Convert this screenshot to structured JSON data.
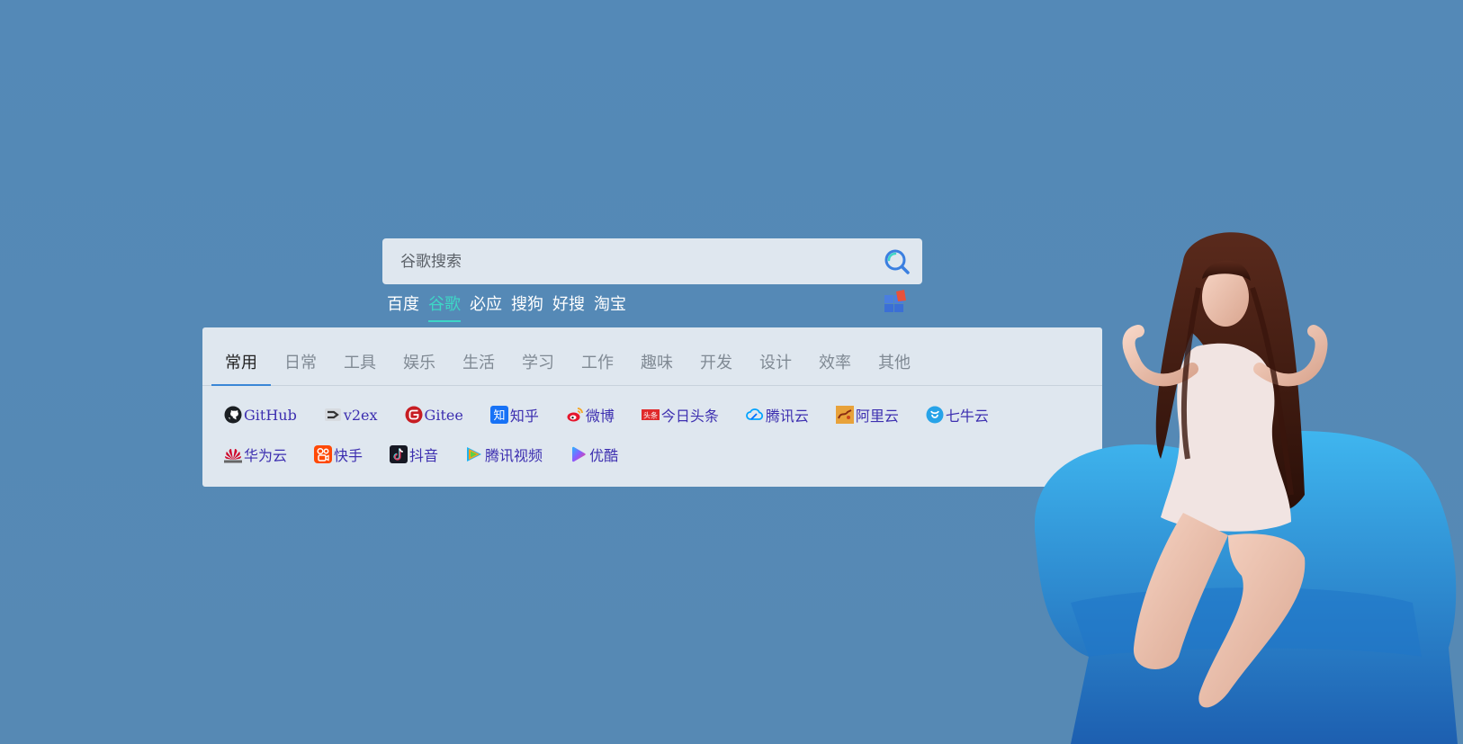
{
  "search": {
    "placeholder": "谷歌搜索"
  },
  "engines": [
    {
      "label": "百度",
      "active": false
    },
    {
      "label": "谷歌",
      "active": true
    },
    {
      "label": "必应",
      "active": false
    },
    {
      "label": "搜狗",
      "active": false
    },
    {
      "label": "好搜",
      "active": false
    },
    {
      "label": "淘宝",
      "active": false
    }
  ],
  "tabs": [
    {
      "label": "常用",
      "active": true
    },
    {
      "label": "日常"
    },
    {
      "label": "工具"
    },
    {
      "label": "娱乐"
    },
    {
      "label": "生活"
    },
    {
      "label": "学习"
    },
    {
      "label": "工作"
    },
    {
      "label": "趣味"
    },
    {
      "label": "开发"
    },
    {
      "label": "设计"
    },
    {
      "label": "效率"
    },
    {
      "label": "其他"
    }
  ],
  "links": [
    {
      "label": "GitHub",
      "icon": "github-icon"
    },
    {
      "label": "v2ex",
      "icon": "v2ex-icon"
    },
    {
      "label": "Gitee",
      "icon": "gitee-icon"
    },
    {
      "label": "知乎",
      "icon": "zhihu-icon"
    },
    {
      "label": "微博",
      "icon": "weibo-icon"
    },
    {
      "label": "今日头条",
      "icon": "toutiao-icon"
    },
    {
      "label": "腾讯云",
      "icon": "tencent-cloud-icon"
    },
    {
      "label": "阿里云",
      "icon": "aliyun-icon"
    },
    {
      "label": "七牛云",
      "icon": "qiniu-icon"
    },
    {
      "label": "华为云",
      "icon": "huawei-cloud-icon"
    },
    {
      "label": "快手",
      "icon": "kuaishou-icon"
    },
    {
      "label": "抖音",
      "icon": "douyin-icon"
    },
    {
      "label": "腾讯视频",
      "icon": "tencent-video-icon"
    },
    {
      "label": "优酷",
      "icon": "youku-icon"
    }
  ],
  "colors": {
    "background": "#5589b6",
    "panel": "#dfe7ef",
    "active_engine": "#3ed6c6",
    "active_tab_underline": "#3a86d6",
    "link_text": "#3d2fb0"
  },
  "decor": {
    "toutiao_badge": "头条"
  }
}
